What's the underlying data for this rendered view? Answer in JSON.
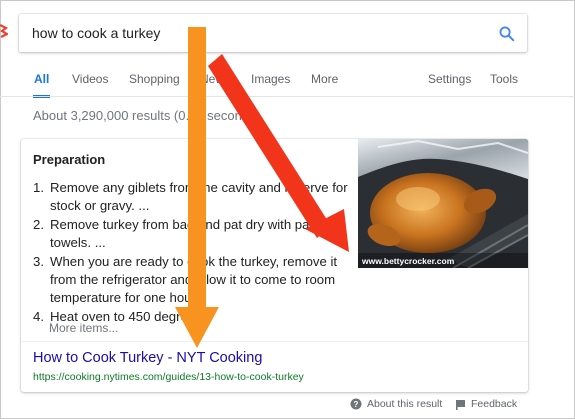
{
  "search": {
    "query": "how to cook a turkey"
  },
  "tabs": [
    {
      "label": "All",
      "active": true
    },
    {
      "label": "Videos"
    },
    {
      "label": "Shopping"
    },
    {
      "label": "News"
    },
    {
      "label": "Images"
    },
    {
      "label": "More"
    },
    {
      "label": "Settings"
    },
    {
      "label": "Tools"
    }
  ],
  "results_stats": "About 3,290,000 results (0.81 seconds)",
  "snippet": {
    "title": "Preparation",
    "steps": [
      {
        "num": "1.",
        "text": "Remove any giblets from the cavity and reserve for stock or gravy. ..."
      },
      {
        "num": "2.",
        "text": "Remove turkey from bag and pat dry with paper towels. ..."
      },
      {
        "num": "3.",
        "text": "When you are ready to cook the turkey, remove it from the refrigerator and allow it to come to room temperature for one hour."
      },
      {
        "num": "4.",
        "text": "Heat oven to 450 degrees."
      }
    ],
    "more_items": "More items...",
    "image_caption": "www.bettycrocker.com",
    "result_title": "How to Cook Turkey - NYT Cooking",
    "result_url": "https://cooking.nytimes.com/guides/13-how-to-cook-turkey"
  },
  "footer": {
    "about": "About this result",
    "feedback": "Feedback"
  },
  "colors": {
    "accent": "#1a73e8",
    "link": "#1a0dab",
    "url": "#0d7a27",
    "arrow_orange": "#f7931e",
    "arrow_red": "#f2341b"
  },
  "icons": [
    "search-icon",
    "question-circle-icon",
    "feedback-flag-icon"
  ]
}
